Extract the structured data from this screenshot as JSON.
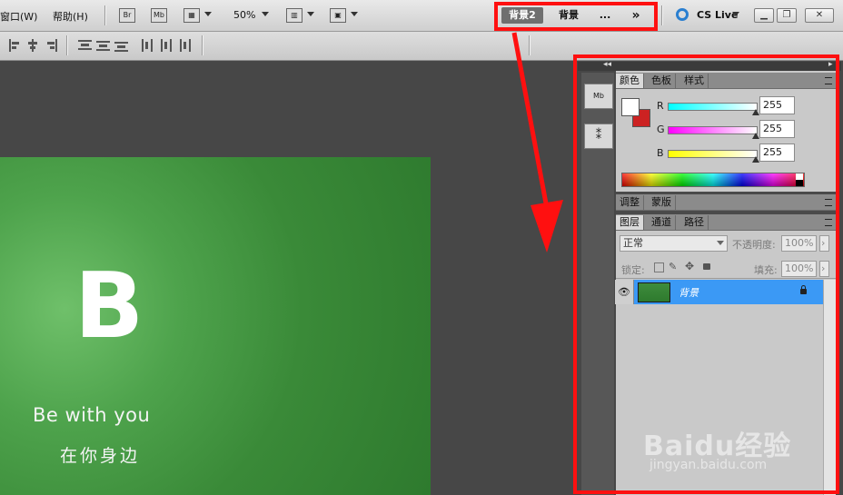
{
  "menubar": {
    "menus": [
      "窗口(W)",
      "帮助(H)"
    ],
    "zoom": "50%",
    "workspaces": [
      "背景2",
      "背景",
      "..."
    ],
    "more": "»",
    "cs_live": "CS Live"
  },
  "canvas": {
    "logo_letter": "B",
    "slogan": "Be with you",
    "slogan_cn": "在你身边"
  },
  "panels": {
    "color": {
      "tabs": [
        "颜色",
        "色板",
        "样式"
      ],
      "sliders": [
        {
          "label": "R",
          "value": "255"
        },
        {
          "label": "G",
          "value": "255"
        },
        {
          "label": "B",
          "value": "255"
        }
      ]
    },
    "adjust": {
      "tabs": [
        "调整",
        "蒙版"
      ]
    },
    "layers": {
      "tabs": [
        "图层",
        "通道",
        "路径"
      ],
      "blend_mode": "正常",
      "opacity_label": "不透明度:",
      "opacity_value": "100%",
      "lock_label": "锁定:",
      "fill_label": "填充:",
      "fill_value": "100%",
      "layer_name": "背景"
    },
    "strip": {
      "mb_label": "Mb"
    }
  },
  "watermark": {
    "main": "Baidu经验",
    "sub": "jingyan.baidu.com"
  },
  "colors": {
    "annotation": "#ff1010",
    "layer_selected": "#3b99f5"
  }
}
